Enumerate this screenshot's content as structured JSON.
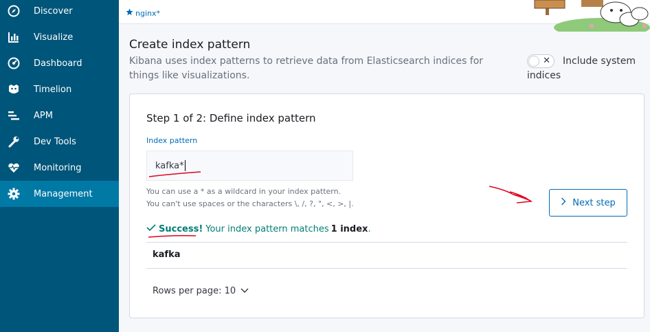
{
  "sidebar": {
    "items": [
      {
        "label": "Discover",
        "icon": "compass-icon"
      },
      {
        "label": "Visualize",
        "icon": "bar-chart-icon"
      },
      {
        "label": "Dashboard",
        "icon": "dashboard-icon"
      },
      {
        "label": "Timelion",
        "icon": "timelion-icon"
      },
      {
        "label": "APM",
        "icon": "apm-icon"
      },
      {
        "label": "Dev Tools",
        "icon": "wrench-icon"
      },
      {
        "label": "Monitoring",
        "icon": "heartbeat-icon"
      },
      {
        "label": "Management",
        "icon": "gear-icon"
      }
    ],
    "active": "Management",
    "bg_color": "#00557a",
    "active_color": "#0079a5"
  },
  "breadcrumb": {
    "label": "nginx*",
    "icon": "star-icon"
  },
  "page": {
    "title": "Create index pattern",
    "description": "Kibana uses index patterns to retrieve data from Elasticsearch indices for things like visualizations.",
    "system_toggle_label": "Include system indices"
  },
  "step": {
    "title": "Step 1 of 2: Define index pattern",
    "field_label": "Index pattern",
    "field_value": "kafka*",
    "help_line1": "You can use a * as a wildcard in your index pattern.",
    "help_line2": "You can't use spaces or the characters \\, /, ?, \", <, >, |.",
    "success_label": "Success!",
    "success_text": "Your index pattern matches",
    "success_count": "1 index",
    "success_period": ".",
    "next_button": "Next step",
    "matches": [
      {
        "name": "kafka"
      }
    ],
    "rows_per_page": "Rows per page: 10"
  },
  "colors": {
    "accent": "#006bb4",
    "success": "#017d73",
    "annotation": "#e0001b"
  }
}
